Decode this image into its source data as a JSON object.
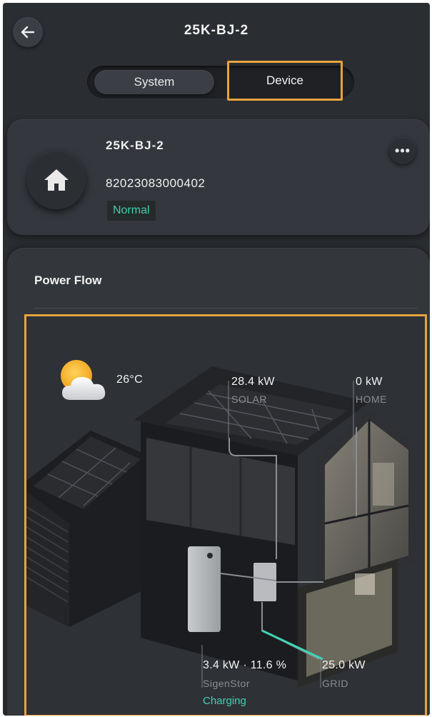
{
  "header": {
    "title": "25K-BJ-2",
    "back_icon": "arrow-left-icon"
  },
  "tabs": [
    {
      "label": "System",
      "selected": false
    },
    {
      "label": "Device",
      "selected": true
    }
  ],
  "device": {
    "name": "25K-BJ-2",
    "serial": "82023083000402",
    "status": "Normal",
    "icon": "home-icon",
    "more_icon": "more-icon",
    "more_label": "•••"
  },
  "power_flow": {
    "title": "Power Flow",
    "weather": {
      "icon": "partly-cloudy-icon",
      "temperature": "26°C"
    },
    "solar": {
      "value": "28.4 kW",
      "label": "SOLAR"
    },
    "home": {
      "value": "0 kW",
      "label": "HOME"
    },
    "battery": {
      "value": "3.4 kW · 11.6 %",
      "label": "SigenStor",
      "state": "Charging"
    },
    "grid": {
      "value": "25.0 kW",
      "label": "GRID"
    }
  },
  "colors": {
    "background": "#2a2d32",
    "card": "#34373d",
    "accent_status": "#3fcfae",
    "highlight_border": "#e8a33c"
  }
}
